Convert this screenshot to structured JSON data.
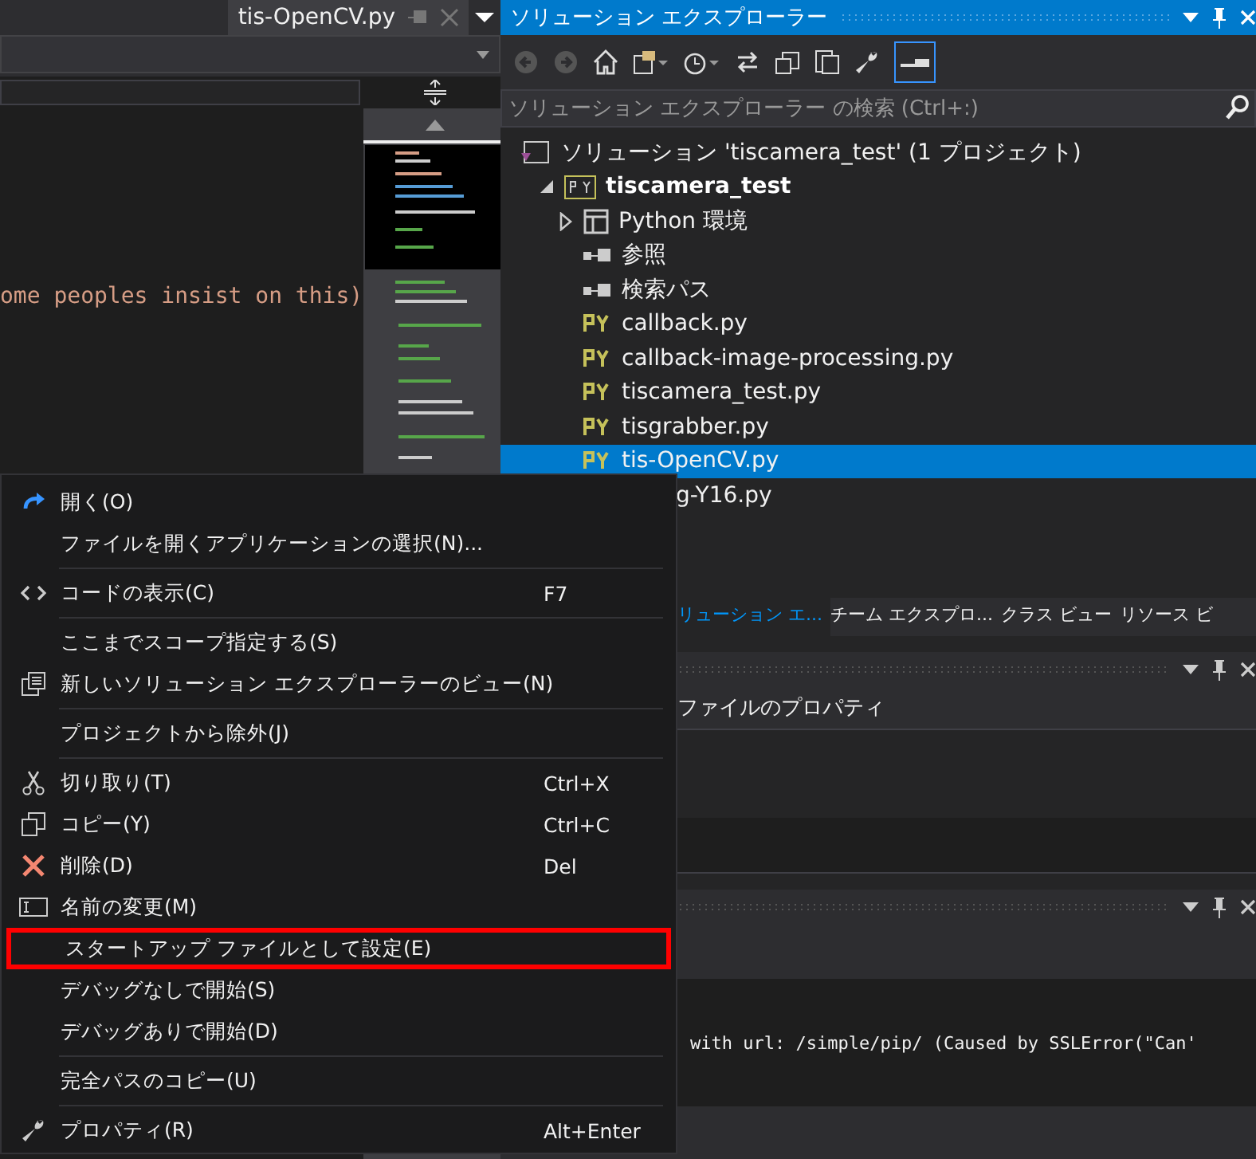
{
  "editor": {
    "tab": {
      "title": "tis-OpenCV.py"
    },
    "code_line": "ome peoples insist on this)"
  },
  "solution_explorer": {
    "title": "ソリューション エクスプローラー",
    "search": {
      "placeholder": "ソリューション エクスプローラー の検索 (Ctrl+:)"
    },
    "items": [
      {
        "kind": "solution",
        "label": "ソリューション 'tiscamera_test' (1 プロジェクト)",
        "selected": false,
        "children": [
          {
            "kind": "project",
            "label": "tiscamera_test",
            "selected": false,
            "expanded": true,
            "children": [
              {
                "kind": "folder",
                "label": "Python 環境",
                "selected": false,
                "expanded": false
              },
              {
                "kind": "ref",
                "label": "参照",
                "selected": false
              },
              {
                "kind": "ref",
                "label": "検索パス",
                "selected": false
              },
              {
                "kind": "file",
                "label": "callback.py",
                "selected": false
              },
              {
                "kind": "file",
                "label": "callback-image-processing.py",
                "selected": false
              },
              {
                "kind": "file",
                "label": "tiscamera_test.py",
                "selected": false
              },
              {
                "kind": "file",
                "label": "tisgrabber.py",
                "selected": false
              },
              {
                "kind": "file",
                "label": "tis-OpenCV.py",
                "selected": true
              },
              {
                "kind": "partial",
                "label": "g-Y16.py",
                "selected": false
              }
            ]
          }
        ]
      }
    ]
  },
  "tool_tabs": [
    {
      "label": "リューション エ...",
      "selected": true
    },
    {
      "label": "チーム エクスプロ...",
      "selected": false
    },
    {
      "label": "クラス ビュー",
      "selected": false
    },
    {
      "label": "リソース ビ",
      "selected": false
    }
  ],
  "properties": {
    "title": "ファイルのプロパティ"
  },
  "output": {
    "text": "with url: /simple/pip/ (Caused by SSLError(\"Can'"
  },
  "context_menu": {
    "groups": [
      [
        {
          "kind": "open",
          "label": "開く(O)",
          "highlighted": false
        },
        {
          "kind": "plain",
          "label": "ファイルを開くアプリケーションの選択(N)...",
          "highlighted": false
        }
      ],
      [
        {
          "kind": "code",
          "label": "コードの表示(C)",
          "shortcut": "F7",
          "highlighted": false
        }
      ],
      [
        {
          "kind": "plain",
          "label": "ここまでスコープ指定する(S)",
          "highlighted": false
        },
        {
          "kind": "view",
          "label": "新しいソリューション エクスプローラーのビュー(N)",
          "highlighted": false
        }
      ],
      [
        {
          "kind": "plain",
          "label": "プロジェクトから除外(J)",
          "highlighted": false
        }
      ],
      [
        {
          "kind": "cut",
          "label": "切り取り(T)",
          "shortcut": "Ctrl+X",
          "highlighted": false
        },
        {
          "kind": "copy",
          "label": "コピー(Y)",
          "shortcut": "Ctrl+C",
          "highlighted": false
        },
        {
          "kind": "delete",
          "label": "削除(D)",
          "shortcut": "Del",
          "highlighted": false
        },
        {
          "kind": "rename",
          "label": "名前の変更(M)",
          "highlighted": false
        },
        {
          "kind": "plain",
          "label": "スタートアップ ファイルとして設定(E)",
          "highlighted": true
        },
        {
          "kind": "plain",
          "label": "デバッグなしで開始(S)",
          "highlighted": false
        },
        {
          "kind": "plain",
          "label": "デバッグありで開始(D)",
          "highlighted": false
        }
      ],
      [
        {
          "kind": "plain",
          "label": "完全パスのコピー(U)",
          "highlighted": false
        }
      ],
      [
        {
          "kind": "properties",
          "label": "プロパティ(R)",
          "shortcut": "Alt+Enter",
          "highlighted": false
        }
      ]
    ]
  }
}
